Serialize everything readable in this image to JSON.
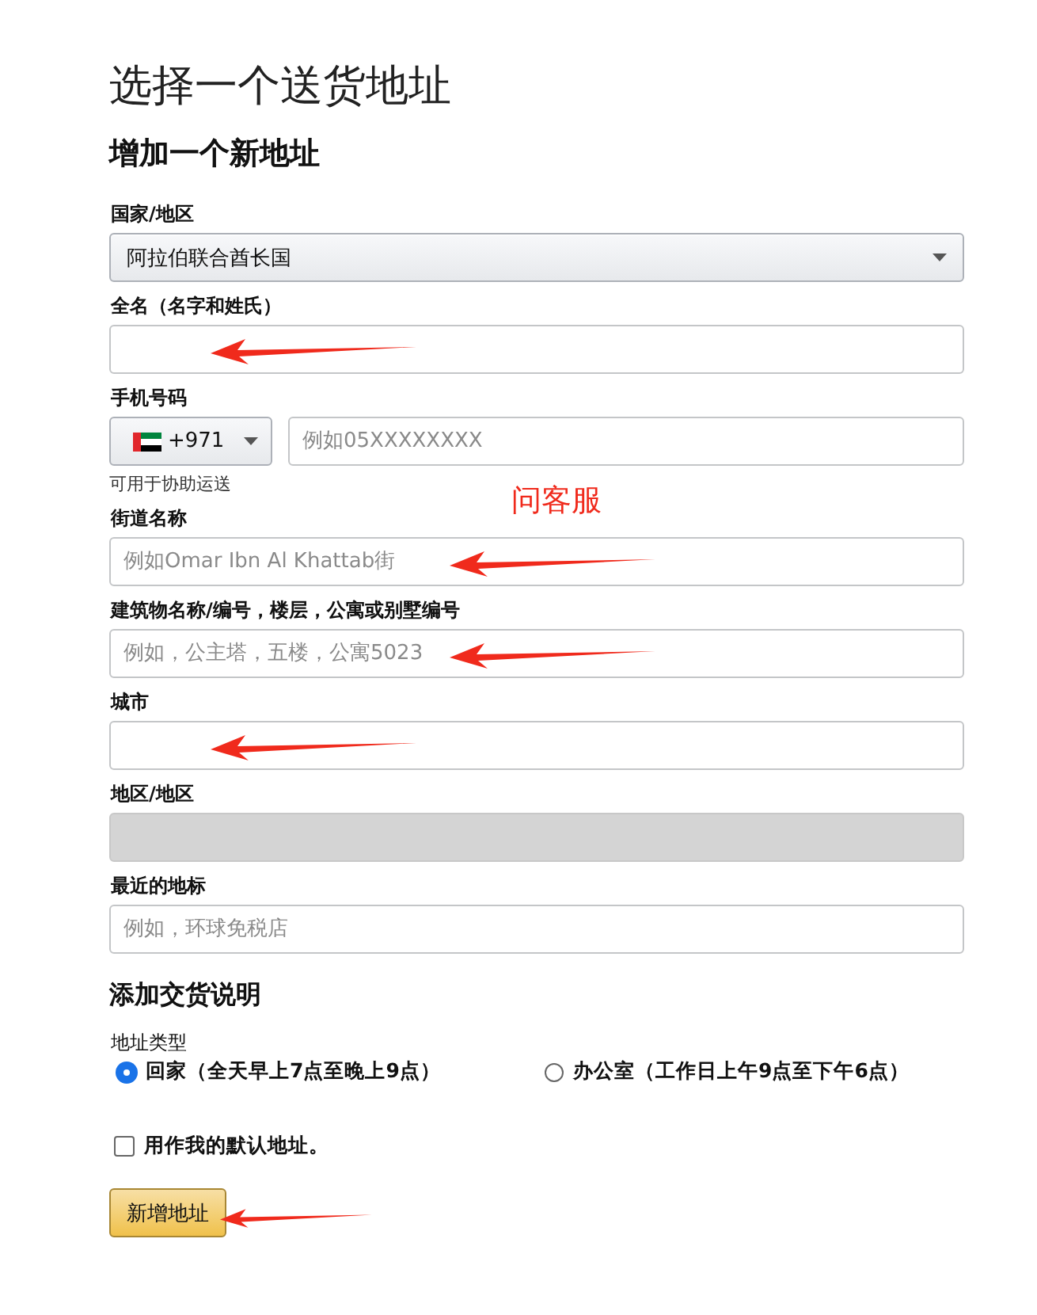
{
  "title": "选择一个送货地址",
  "subtitle": "增加一个新地址",
  "fields": [
    {
      "kind": "select",
      "label": "国家/地区",
      "value": "阿拉伯联合酋长国",
      "arrow": false
    },
    {
      "kind": "text",
      "label": "全名（名字和姓氏）",
      "arrow": true
    },
    {
      "kind": "phone",
      "label": "手机号码",
      "code": "+971",
      "placeholder": "例如05XXXXXXXX",
      "hint": "可用于协助运送",
      "arrow": false
    },
    {
      "kind": "text",
      "label": "街道名称",
      "placeholder": "例如Omar Ibn Al Khattab街",
      "arrow": true,
      "note": "问客服"
    },
    {
      "kind": "text",
      "label": "建筑物名称/编号，楼层，公寓或别墅编号",
      "placeholder": "例如，公主塔，五楼，公寓5023",
      "arrow": true
    },
    {
      "kind": "text",
      "label": "城市",
      "arrow": true
    },
    {
      "kind": "disabled",
      "label": "地区/地区",
      "arrow": false
    },
    {
      "kind": "text",
      "label": "最近的地标",
      "placeholder": "例如，环球免税店",
      "arrow": false
    }
  ],
  "instructions": {
    "heading": "添加交货说明",
    "label": "地址类型",
    "options": [
      {
        "label": "回家（全天早上7点至晚上9点）",
        "selected": true
      },
      {
        "label": "办公室（工作日上午9点至下午6点）",
        "selected": false
      }
    ]
  },
  "default_address": {
    "label": "用作我的默认地址。",
    "checked": false
  },
  "submit": {
    "label": "新增地址",
    "arrow": true
  }
}
